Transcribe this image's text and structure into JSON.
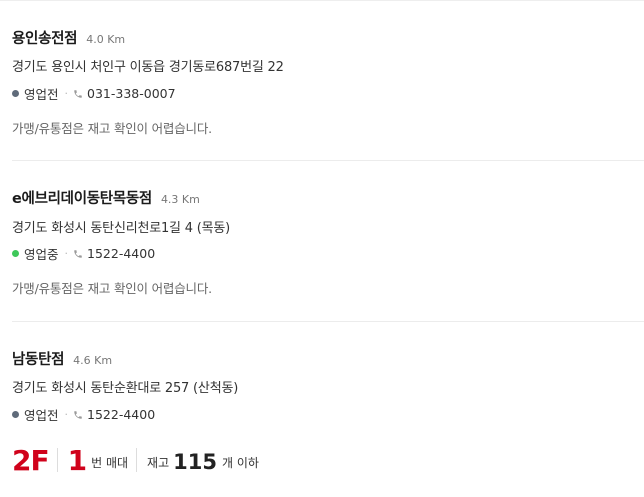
{
  "stores": [
    {
      "name": "용인송전점",
      "distance": "4.0 Km",
      "address": "경기도 용인시 처인구 이동읍 경기동로687번길 22",
      "status": "영업전",
      "status_color": "#5f6b7a",
      "phone": "031-338-0007",
      "notice": "가맹/유통점은 재고 확인이 어렵습니다."
    },
    {
      "name": "e에브리데이동탄목동점",
      "distance": "4.3 Km",
      "address": "경기도 화성시 동탄신리천로1길 4 (목동)",
      "status": "영업중",
      "status_color": "#3ec85a",
      "phone": "1522-4400",
      "notice": "가맹/유통점은 재고 확인이 어렵습니다."
    },
    {
      "name": "남동탄점",
      "distance": "4.6 Km",
      "address": "경기도 화성시 동탄순환대로 257 (산척동)",
      "status": "영업전",
      "status_color": "#5f6b7a",
      "phone": "1522-4400",
      "stock": {
        "floor": "2F",
        "aisle_number": "1",
        "aisle_label": "번 매대",
        "stock_label": "재고",
        "stock_count": "115",
        "stock_unit": "개 이하"
      }
    }
  ],
  "icons": {
    "phone": "phone-icon",
    "status": "status-dot"
  },
  "colors": {
    "accent_red": "#d0021b",
    "divider": "#ececec"
  }
}
